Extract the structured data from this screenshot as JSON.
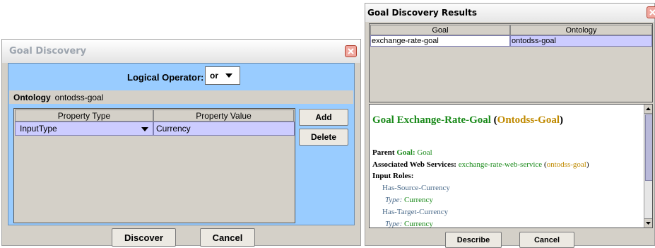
{
  "left_dialog": {
    "title": "Goal Discovery",
    "operator_label": "Logical Operator:",
    "operator_value": "or",
    "ontology_label": "Ontology",
    "ontology_value": "ontodss-goal",
    "columns": [
      "Property Type",
      "Property Value"
    ],
    "rows": [
      {
        "type": "InputType",
        "value": "Currency"
      }
    ],
    "add_label": "Add",
    "delete_label": "Delete",
    "discover_label": "Discover",
    "cancel_label": "Cancel"
  },
  "right_dialog": {
    "title": "Goal Discovery Results",
    "columns": [
      "Goal",
      "Ontology"
    ],
    "rows": [
      {
        "goal": "exchange-rate-goal",
        "ontology": "ontodss-goal"
      }
    ],
    "detail": {
      "heading_prefix": "Goal Exchange-Rate-Goal",
      "heading_ontology": "Ontodss-Goal",
      "parent_label": "Parent",
      "parent_kind": "Goal:",
      "parent_value": "Goal",
      "services_label": "Associated Web Services:",
      "service_name": "exchange-rate-web-service",
      "service_ontology": "ontodss-goal",
      "input_roles_label": "Input Roles:",
      "roles": [
        {
          "name": "Has-Source-Currency",
          "type_label": "Type:",
          "type_value": "Currency"
        },
        {
          "name": "Has-Target-Currency",
          "type_label": "Type:",
          "type_value": "Currency"
        }
      ]
    },
    "describe_label": "Describe",
    "cancel_label": "Cancel"
  },
  "colors": {
    "panel_blue": "#99ccff",
    "selection": "#ccccff",
    "green_link": "#1a8a1a",
    "ontology_gold": "#c08a00",
    "role_slate": "#4a6a8a",
    "close_red": "#f0a8a0"
  }
}
